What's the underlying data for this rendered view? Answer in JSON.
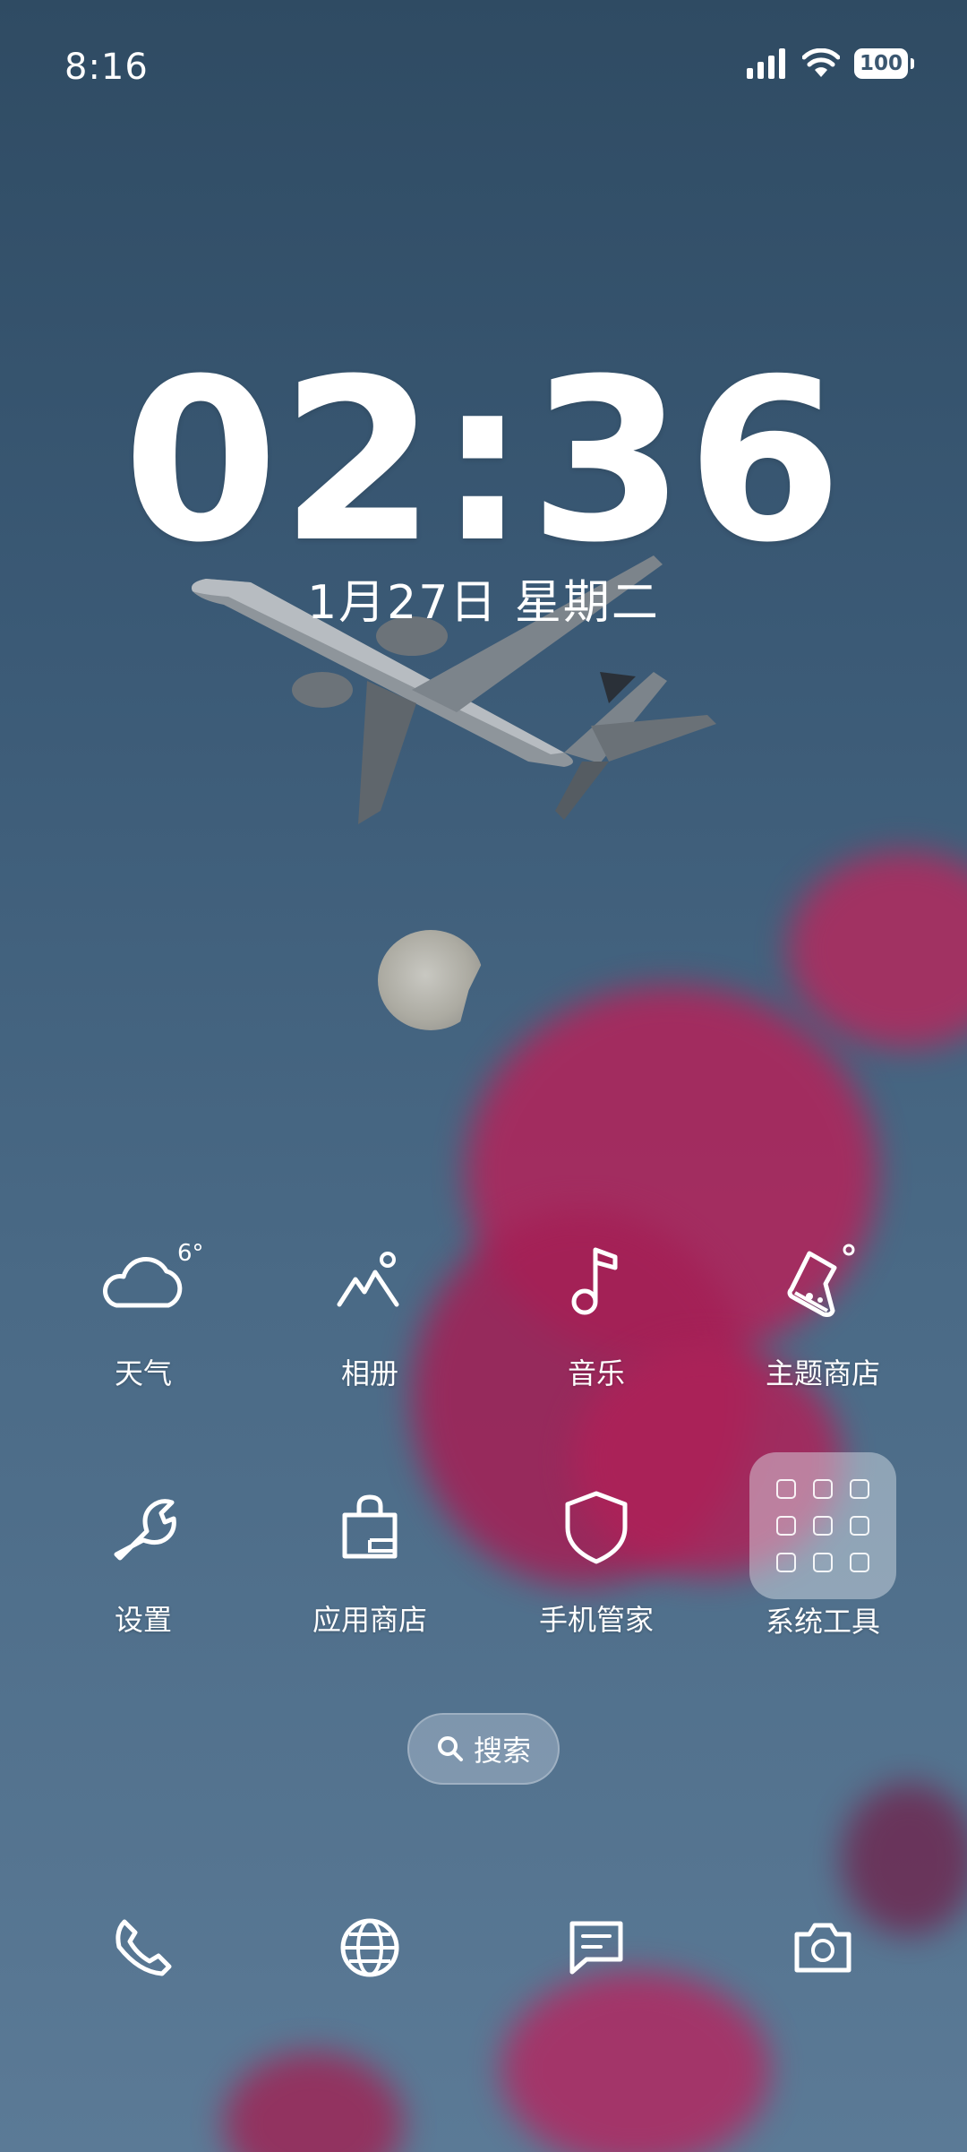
{
  "status_bar": {
    "time": "8:16",
    "battery": "100"
  },
  "lock_clock": {
    "time": "02:36",
    "date": "1月27日 星期二"
  },
  "weather": {
    "temperature": "6°"
  },
  "apps": [
    {
      "label": "天气",
      "icon": "cloud-icon"
    },
    {
      "label": "相册",
      "icon": "mountain-photo-icon"
    },
    {
      "label": "音乐",
      "icon": "music-note-icon"
    },
    {
      "label": "主题商店",
      "icon": "flask-icon"
    },
    {
      "label": "设置",
      "icon": "wrench-icon"
    },
    {
      "label": "应用商店",
      "icon": "shopping-bag-icon"
    },
    {
      "label": "手机管家",
      "icon": "shield-icon"
    },
    {
      "label": "系统工具",
      "icon": "folder-icon"
    }
  ],
  "search": {
    "label": "搜索"
  },
  "dock": [
    {
      "icon": "phone-icon"
    },
    {
      "icon": "globe-icon"
    },
    {
      "icon": "message-icon"
    },
    {
      "icon": "camera-icon"
    }
  ],
  "colors": {
    "wallpaper_top": "#2f4b63",
    "wallpaper_bottom": "#5b7a96",
    "flower": "#b3235a"
  }
}
